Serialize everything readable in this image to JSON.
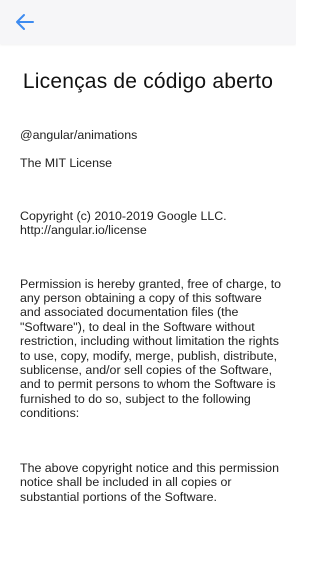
{
  "header": {
    "back_icon": "arrow-left-icon",
    "accent_color": "#3d8bf0"
  },
  "page": {
    "title": "Licenças de código aberto"
  },
  "license": {
    "package_name": "@angular/animations",
    "license_name": "The MIT License",
    "copyright": "Copyright (c) 2010-2019 Google LLC.\nhttp://angular.io/license",
    "permission": "Permission is hereby granted, free of charge, to any person obtaining a copy of this software and associated documentation files (the \"Software\"), to deal in the Software without restriction, including without limitation the rights to use, copy, modify, merge, publish, distribute, sublicense, and/or sell copies of the Software, and to permit persons to whom the Software is furnished to do so, subject to the following conditions:",
    "notice": "The above copyright notice and this permission notice shall be included in all copies or substantial portions of the Software."
  }
}
